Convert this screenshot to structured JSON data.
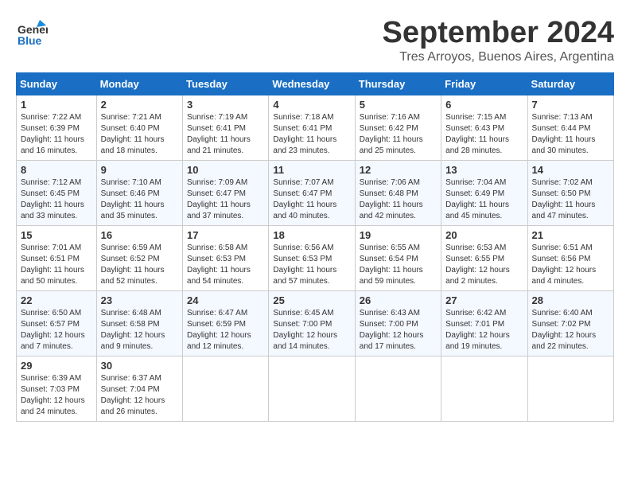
{
  "header": {
    "logo_general": "General",
    "logo_blue": "Blue",
    "month": "September 2024",
    "location": "Tres Arroyos, Buenos Aires, Argentina"
  },
  "columns": [
    "Sunday",
    "Monday",
    "Tuesday",
    "Wednesday",
    "Thursday",
    "Friday",
    "Saturday"
  ],
  "weeks": [
    [
      {
        "day": "1",
        "info": "Sunrise: 7:22 AM\nSunset: 6:39 PM\nDaylight: 11 hours\nand 16 minutes."
      },
      {
        "day": "2",
        "info": "Sunrise: 7:21 AM\nSunset: 6:40 PM\nDaylight: 11 hours\nand 18 minutes."
      },
      {
        "day": "3",
        "info": "Sunrise: 7:19 AM\nSunset: 6:41 PM\nDaylight: 11 hours\nand 21 minutes."
      },
      {
        "day": "4",
        "info": "Sunrise: 7:18 AM\nSunset: 6:41 PM\nDaylight: 11 hours\nand 23 minutes."
      },
      {
        "day": "5",
        "info": "Sunrise: 7:16 AM\nSunset: 6:42 PM\nDaylight: 11 hours\nand 25 minutes."
      },
      {
        "day": "6",
        "info": "Sunrise: 7:15 AM\nSunset: 6:43 PM\nDaylight: 11 hours\nand 28 minutes."
      },
      {
        "day": "7",
        "info": "Sunrise: 7:13 AM\nSunset: 6:44 PM\nDaylight: 11 hours\nand 30 minutes."
      }
    ],
    [
      {
        "day": "8",
        "info": "Sunrise: 7:12 AM\nSunset: 6:45 PM\nDaylight: 11 hours\nand 33 minutes."
      },
      {
        "day": "9",
        "info": "Sunrise: 7:10 AM\nSunset: 6:46 PM\nDaylight: 11 hours\nand 35 minutes."
      },
      {
        "day": "10",
        "info": "Sunrise: 7:09 AM\nSunset: 6:47 PM\nDaylight: 11 hours\nand 37 minutes."
      },
      {
        "day": "11",
        "info": "Sunrise: 7:07 AM\nSunset: 6:47 PM\nDaylight: 11 hours\nand 40 minutes."
      },
      {
        "day": "12",
        "info": "Sunrise: 7:06 AM\nSunset: 6:48 PM\nDaylight: 11 hours\nand 42 minutes."
      },
      {
        "day": "13",
        "info": "Sunrise: 7:04 AM\nSunset: 6:49 PM\nDaylight: 11 hours\nand 45 minutes."
      },
      {
        "day": "14",
        "info": "Sunrise: 7:02 AM\nSunset: 6:50 PM\nDaylight: 11 hours\nand 47 minutes."
      }
    ],
    [
      {
        "day": "15",
        "info": "Sunrise: 7:01 AM\nSunset: 6:51 PM\nDaylight: 11 hours\nand 50 minutes."
      },
      {
        "day": "16",
        "info": "Sunrise: 6:59 AM\nSunset: 6:52 PM\nDaylight: 11 hours\nand 52 minutes."
      },
      {
        "day": "17",
        "info": "Sunrise: 6:58 AM\nSunset: 6:53 PM\nDaylight: 11 hours\nand 54 minutes."
      },
      {
        "day": "18",
        "info": "Sunrise: 6:56 AM\nSunset: 6:53 PM\nDaylight: 11 hours\nand 57 minutes."
      },
      {
        "day": "19",
        "info": "Sunrise: 6:55 AM\nSunset: 6:54 PM\nDaylight: 11 hours\nand 59 minutes."
      },
      {
        "day": "20",
        "info": "Sunrise: 6:53 AM\nSunset: 6:55 PM\nDaylight: 12 hours\nand 2 minutes."
      },
      {
        "day": "21",
        "info": "Sunrise: 6:51 AM\nSunset: 6:56 PM\nDaylight: 12 hours\nand 4 minutes."
      }
    ],
    [
      {
        "day": "22",
        "info": "Sunrise: 6:50 AM\nSunset: 6:57 PM\nDaylight: 12 hours\nand 7 minutes."
      },
      {
        "day": "23",
        "info": "Sunrise: 6:48 AM\nSunset: 6:58 PM\nDaylight: 12 hours\nand 9 minutes."
      },
      {
        "day": "24",
        "info": "Sunrise: 6:47 AM\nSunset: 6:59 PM\nDaylight: 12 hours\nand 12 minutes."
      },
      {
        "day": "25",
        "info": "Sunrise: 6:45 AM\nSunset: 7:00 PM\nDaylight: 12 hours\nand 14 minutes."
      },
      {
        "day": "26",
        "info": "Sunrise: 6:43 AM\nSunset: 7:00 PM\nDaylight: 12 hours\nand 17 minutes."
      },
      {
        "day": "27",
        "info": "Sunrise: 6:42 AM\nSunset: 7:01 PM\nDaylight: 12 hours\nand 19 minutes."
      },
      {
        "day": "28",
        "info": "Sunrise: 6:40 AM\nSunset: 7:02 PM\nDaylight: 12 hours\nand 22 minutes."
      }
    ],
    [
      {
        "day": "29",
        "info": "Sunrise: 6:39 AM\nSunset: 7:03 PM\nDaylight: 12 hours\nand 24 minutes."
      },
      {
        "day": "30",
        "info": "Sunrise: 6:37 AM\nSunset: 7:04 PM\nDaylight: 12 hours\nand 26 minutes."
      },
      {
        "day": "",
        "info": ""
      },
      {
        "day": "",
        "info": ""
      },
      {
        "day": "",
        "info": ""
      },
      {
        "day": "",
        "info": ""
      },
      {
        "day": "",
        "info": ""
      }
    ]
  ]
}
